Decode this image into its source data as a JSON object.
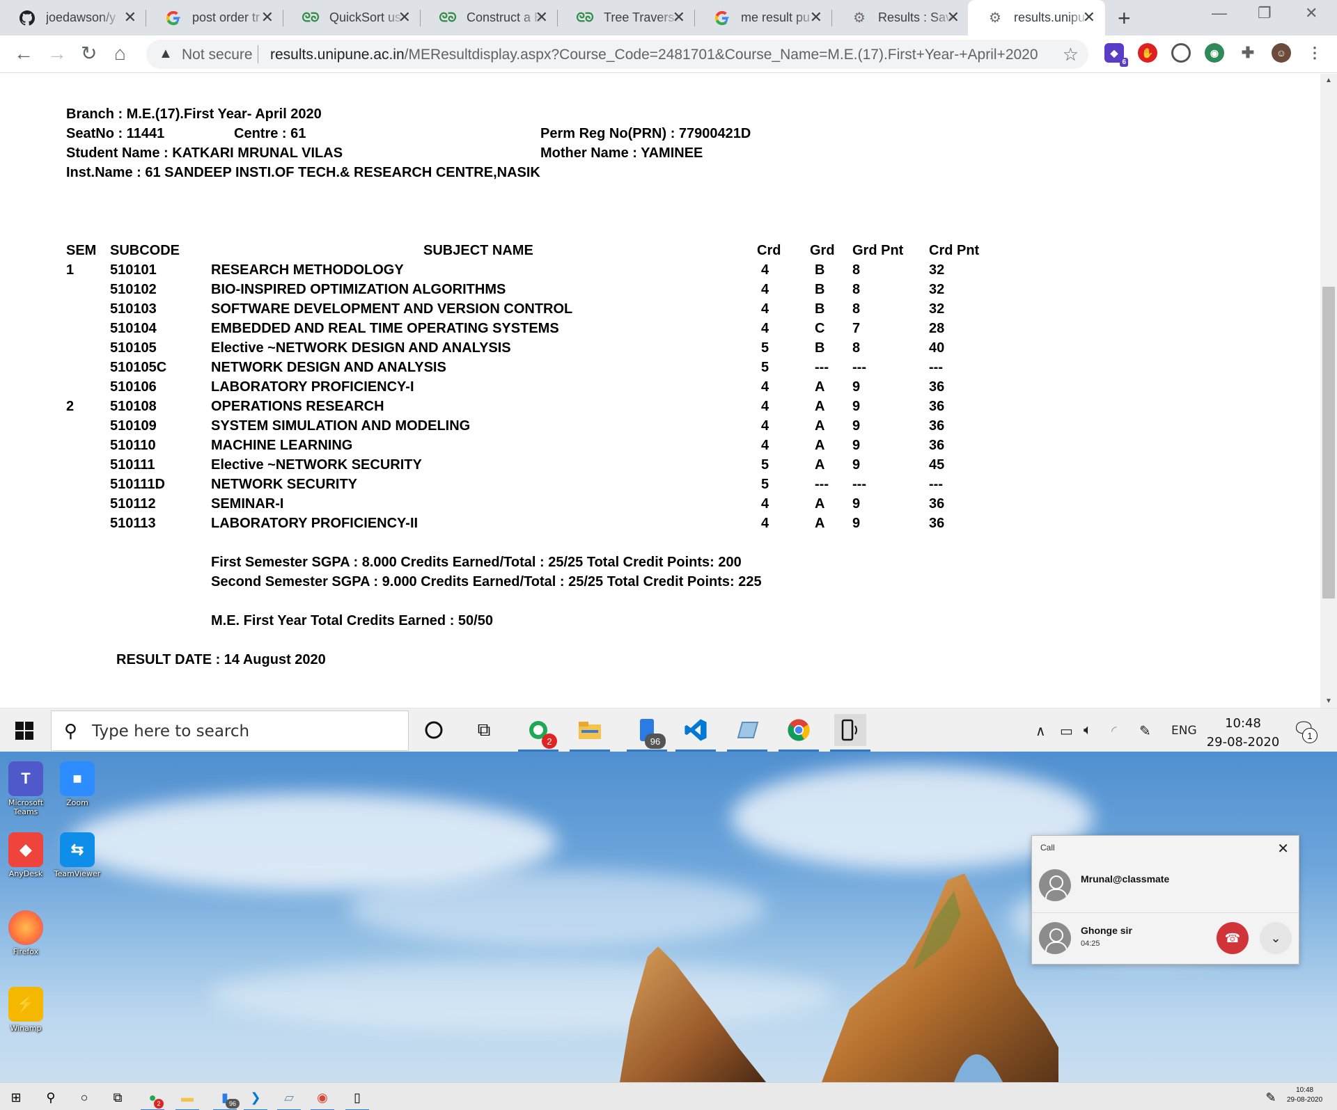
{
  "browser": {
    "tabs": [
      {
        "title": "joedawson/y",
        "icon": "github-icon"
      },
      {
        "title": "post order tr",
        "icon": "google-icon"
      },
      {
        "title": "QuickSort us",
        "icon": "gfg-icon"
      },
      {
        "title": "Construct a B",
        "icon": "gfg-icon"
      },
      {
        "title": "Tree Traversa",
        "icon": "gfg-icon"
      },
      {
        "title": "me result pu",
        "icon": "google-icon"
      },
      {
        "title": "Results : Savi",
        "icon": "university-icon"
      },
      {
        "title": "results.unipu",
        "icon": "university-icon",
        "active": true
      }
    ],
    "security": "Not secure",
    "url_host": "results.unipune.ac.in",
    "url_path": "/MEResultdisplay.aspx?Course_Code=2481701&Course_Name=M.E.(17).First+Year-+April+2020",
    "extension_badge": "6"
  },
  "result": {
    "branch": "Branch : M.E.(17).First Year- April 2020",
    "seat_no": "SeatNo : 11441",
    "centre": "Centre : 61",
    "prn": "Perm Reg No(PRN) : 77900421D",
    "student_name": "Student Name : KATKARI MRUNAL VILAS",
    "mother_name": "Mother Name : YAMINEE",
    "inst_name": "Inst.Name : 61  SANDEEP INSTI.OF TECH.& RESEARCH CENTRE,NASIK",
    "headers": {
      "sem": "SEM",
      "subcode": "SUBCODE",
      "subject": "SUBJECT NAME",
      "crd": "Crd",
      "grd": "Grd",
      "grd_pnt": "Grd Pnt",
      "crd_pnt": "Crd Pnt"
    },
    "rows": [
      {
        "sem": "1",
        "code": "510101",
        "name": "RESEARCH METHODOLOGY",
        "crd": "4",
        "grd": "B",
        "gp": "8",
        "cp": "32"
      },
      {
        "sem": "",
        "code": "510102",
        "name": "BIO-INSPIRED OPTIMIZATION ALGORITHMS",
        "crd": "4",
        "grd": "B",
        "gp": "8",
        "cp": "32"
      },
      {
        "sem": "",
        "code": "510103",
        "name": "SOFTWARE DEVELOPMENT AND VERSION CONTROL",
        "crd": "4",
        "grd": "B",
        "gp": "8",
        "cp": "32"
      },
      {
        "sem": "",
        "code": "510104",
        "name": "EMBEDDED AND REAL TIME OPERATING SYSTEMS",
        "crd": "4",
        "grd": "C",
        "gp": "7",
        "cp": "28"
      },
      {
        "sem": "",
        "code": "510105",
        "name": "Elective ~NETWORK DESIGN AND ANALYSIS",
        "crd": "5",
        "grd": "B",
        "gp": "8",
        "cp": "40"
      },
      {
        "sem": "",
        "code": "510105C",
        "name": "NETWORK DESIGN AND ANALYSIS",
        "crd": "5",
        "grd": "---",
        "gp": "---",
        "cp": "---"
      },
      {
        "sem": "",
        "code": "510106",
        "name": "LABORATORY PROFICIENCY-I",
        "crd": "4",
        "grd": "A",
        "gp": "9",
        "cp": "36"
      },
      {
        "sem": "2",
        "code": "510108",
        "name": "OPERATIONS RESEARCH",
        "crd": "4",
        "grd": "A",
        "gp": "9",
        "cp": "36"
      },
      {
        "sem": "",
        "code": "510109",
        "name": "SYSTEM SIMULATION AND MODELING",
        "crd": "4",
        "grd": "A",
        "gp": "9",
        "cp": "36"
      },
      {
        "sem": "",
        "code": "510110",
        "name": "MACHINE LEARNING",
        "crd": "4",
        "grd": "A",
        "gp": "9",
        "cp": "36"
      },
      {
        "sem": "",
        "code": "510111",
        "name": "Elective ~NETWORK SECURITY",
        "crd": "5",
        "grd": "A",
        "gp": "9",
        "cp": "45"
      },
      {
        "sem": "",
        "code": "510111D",
        "name": "NETWORK SECURITY",
        "crd": "5",
        "grd": "---",
        "gp": "---",
        "cp": "---"
      },
      {
        "sem": "",
        "code": "510112",
        "name": "SEMINAR-I",
        "crd": "4",
        "grd": "A",
        "gp": "9",
        "cp": "36"
      },
      {
        "sem": "",
        "code": "510113",
        "name": "LABORATORY PROFICIENCY-II",
        "crd": "4",
        "grd": "A",
        "gp": "9",
        "cp": "36"
      }
    ],
    "sgpa1": "First Semester SGPA : 8.000 Credits Earned/Total : 25/25 Total Credit Points: 200",
    "sgpa2": "Second Semester SGPA : 9.000 Credits Earned/Total : 25/25 Total Credit Points: 225",
    "total_credits": "M.E. First Year Total Credits Earned : 50/50",
    "result_date": "RESULT DATE : 14 August 2020"
  },
  "taskbar": {
    "search_placeholder": "Type here to search",
    "whatsapp_badge": "2",
    "phone_badge": "96",
    "language": "ENG",
    "time": "10:48",
    "date": "29-08-2020",
    "notifications": "1"
  },
  "desktop_icons": [
    {
      "label": "Microsoft Teams",
      "color": "#5059c9"
    },
    {
      "label": "Zoom",
      "color": "#2d8cff"
    },
    {
      "label": "AnyDesk",
      "color": "#ef443b"
    },
    {
      "label": "TeamViewer",
      "color": "#0e8ee9"
    },
    {
      "label": "Firefox",
      "color": "#ff7139"
    },
    {
      "label": "Winamp",
      "color": "#f5b800"
    }
  ],
  "call_popup": {
    "header": "Call",
    "caller1": "Mrunal@classmate",
    "caller2": "Ghonge sir",
    "duration": "04:25"
  },
  "minibar": {
    "whatsapp_badge": "2",
    "phone_badge": "96",
    "time": "10:48",
    "date": "29-08-2020"
  }
}
